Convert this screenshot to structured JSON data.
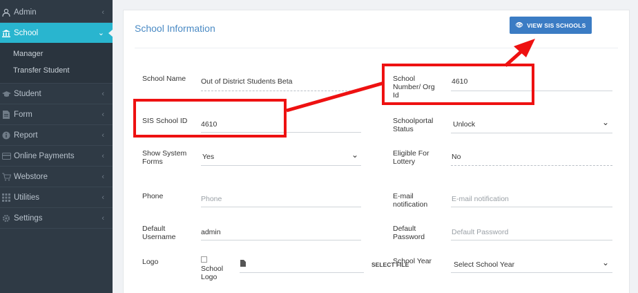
{
  "sidebar": {
    "items": [
      {
        "label": "Admin",
        "icon": "user-icon"
      },
      {
        "label": "School",
        "icon": "bank-icon"
      },
      {
        "label": "Student",
        "icon": "graduation-cap-icon"
      },
      {
        "label": "Form",
        "icon": "file-icon"
      },
      {
        "label": "Report",
        "icon": "info-icon"
      },
      {
        "label": "Online Payments",
        "icon": "card-icon"
      },
      {
        "label": "Webstore",
        "icon": "cart-icon"
      },
      {
        "label": "Utilities",
        "icon": "grid-icon"
      },
      {
        "label": "Settings",
        "icon": "gear-icon"
      }
    ],
    "sub_items": [
      "Manager",
      "Transfer Student"
    ]
  },
  "panel": {
    "title": "School Information",
    "view_button": "VIEW SIS SCHOOLS"
  },
  "form": {
    "school_name_label": "School Name",
    "school_name_value": "Out of District Students Beta",
    "school_number_label": "School Number/ Org Id",
    "school_number_value": "4610",
    "sis_id_label": "SIS School ID",
    "sis_id_value": "4610",
    "portal_status_label": "Schoolportal Status",
    "portal_status_value": "Unlock",
    "show_forms_label": "Show System Forms",
    "show_forms_value": "Yes",
    "lottery_label": "Eligible For Lottery",
    "lottery_value": "No",
    "phone_label": "Phone",
    "phone_placeholder": "Phone",
    "email_label": "E-mail notification",
    "email_placeholder": "E-mail notification",
    "username_label": "Default Username",
    "username_value": "admin",
    "password_label": "Default Password",
    "password_placeholder": "Default Password",
    "logo_label": "Logo",
    "logo_alt": "School Logo",
    "select_file": "SELECT FILE",
    "school_year_label": "School Year",
    "school_year_value": "Select School Year"
  },
  "colors": {
    "sidebar_bg": "#2f3a45",
    "active": "#29b5cf",
    "button": "#3b7cc4",
    "annotation": "#ee1111"
  }
}
